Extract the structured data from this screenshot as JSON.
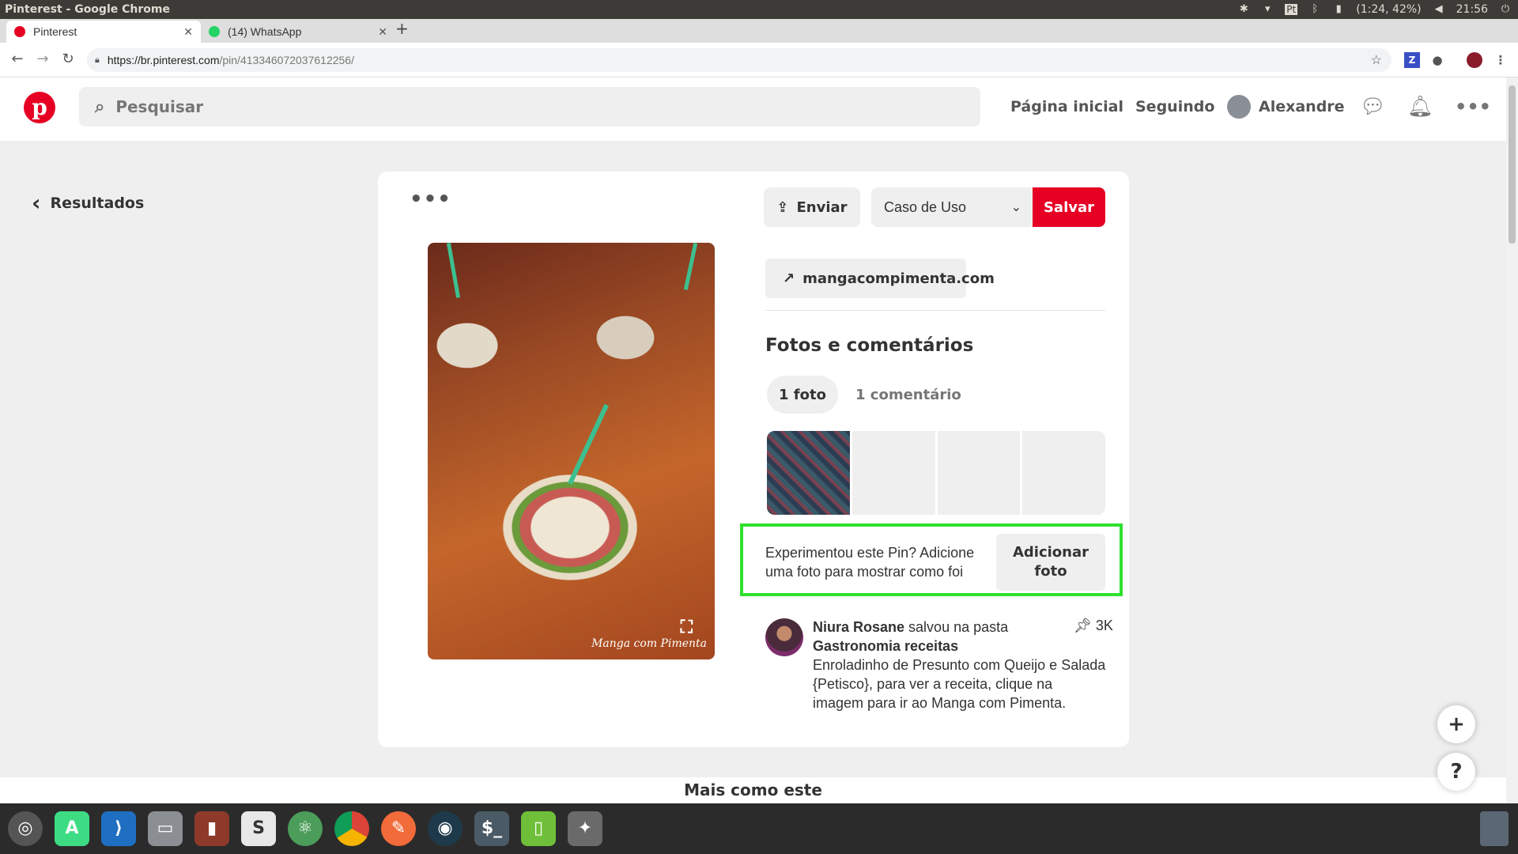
{
  "os": {
    "window_title": "Pinterest - Google Chrome",
    "lang": "Pt",
    "battery": "(1:24, 42%)",
    "clock": "21:56"
  },
  "chrome": {
    "tabs": [
      {
        "label": "Pinterest",
        "color": "#e60023"
      },
      {
        "label": "(14) WhatsApp",
        "color": "#25d366"
      }
    ],
    "url_host": "https://br.pinterest.com",
    "url_path": "/pin/413346072037612256/"
  },
  "header": {
    "search_placeholder": "Pesquisar",
    "nav_home": "Página inicial",
    "nav_following": "Seguindo",
    "user_name": "Alexandre"
  },
  "page": {
    "back_label": "Resultados",
    "send_label": "Enviar",
    "board_selected": "Caso de Uso",
    "save_label": "Salvar",
    "source_link": "mangacompimenta.com",
    "section_title": "Fotos e comentários",
    "tab_photos": "1 foto",
    "tab_comments": "1 comentário",
    "try_prompt": "Experimentou este Pin? Adicione uma foto para mostrar como foi",
    "add_photo_label": "Adicionar foto",
    "watermark": "Manga com Pimenta",
    "comment": {
      "author": "Niura Rosane",
      "action": " salvou na pasta",
      "board": "Gastronomia receitas",
      "text": "Enroladinho de Presunto com Queijo e Salada {Petisco}, para ver a receita, clique na imagem para ir ao Manga com Pimenta.",
      "saves": "3K"
    },
    "more_like_this": "Mais como este",
    "float_add": "+",
    "float_help": "?"
  },
  "colors": {
    "brand_red": "#e60023",
    "highlight_green": "#2fe02f"
  }
}
